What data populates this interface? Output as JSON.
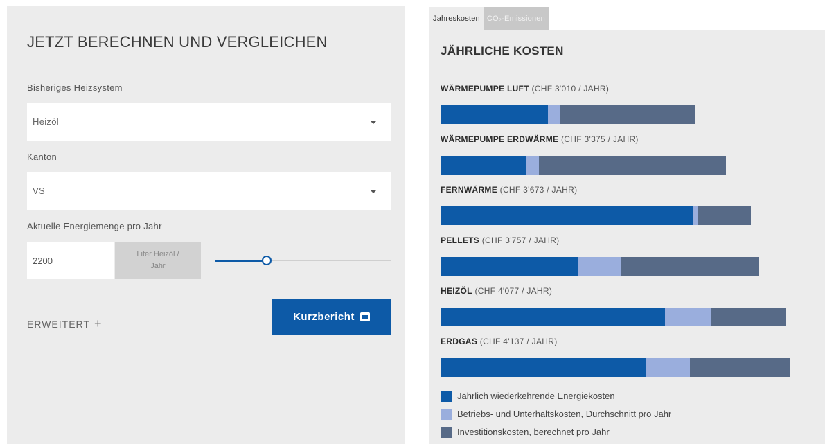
{
  "form": {
    "title": "JETZT BERECHNEN UND VERGLEICHEN",
    "heating_label": "Bisheriges Heizsystem",
    "heating_value": "Heizöl",
    "canton_label": "Kanton",
    "canton_value": "VS",
    "energy_label": "Aktuelle Energiemenge pro Jahr",
    "energy_value": "2200",
    "energy_unit_line1": "Liter Heizöl /",
    "energy_unit_line2": "Jahr",
    "slider_fraction": 0.27,
    "advanced_label": "ERWEITERT",
    "advanced_icon": "plus-icon",
    "report_button": "Kurzbericht",
    "report_icon": "report-icon"
  },
  "tabs": [
    {
      "label": "Jahreskosten",
      "active": true
    },
    {
      "label": "CO₂-Emissionen",
      "active": false
    }
  ],
  "costs_title": "JÄHRLICHE KOSTEN",
  "chart_data": {
    "type": "bar",
    "orientation": "horizontal",
    "stacked": true,
    "categories": [
      {
        "name": "WÄRMEPUMPE LUFT",
        "cost_text": "(CHF 3'010 / JAHR)"
      },
      {
        "name": "WÄRMEPUMPE ERDWÄRME",
        "cost_text": "(CHF 3'375 / JAHR)"
      },
      {
        "name": "FERNWÄRME",
        "cost_text": "(CHF 3'673 / JAHR)"
      },
      {
        "name": "PELLETS",
        "cost_text": "(CHF 3'757 / JAHR)"
      },
      {
        "name": "HEIZÖL",
        "cost_text": "(CHF 4'077 / JAHR)"
      },
      {
        "name": "ERDGAS",
        "cost_text": "(CHF 4'137 / JAHR)"
      }
    ],
    "series": [
      {
        "name": "Jährlich wiederkehrende Energiekosten",
        "color": "#0d5aa7",
        "values": [
          1270,
          1017,
          2989,
          1622,
          2654,
          2426
        ]
      },
      {
        "name": "Betriebs- und Unterhaltskosten, Durchschnitt pro Jahr",
        "color": "#9aaedd",
        "values": [
          147,
          147,
          49,
          508,
          541,
          524
        ]
      },
      {
        "name": "Investitionskosten, berechnet pro Jahr",
        "color": "#576a87",
        "values": [
          1593,
          2211,
          635,
          1627,
          882,
          1187
        ]
      }
    ],
    "xlim": [
      0,
      4137
    ]
  }
}
